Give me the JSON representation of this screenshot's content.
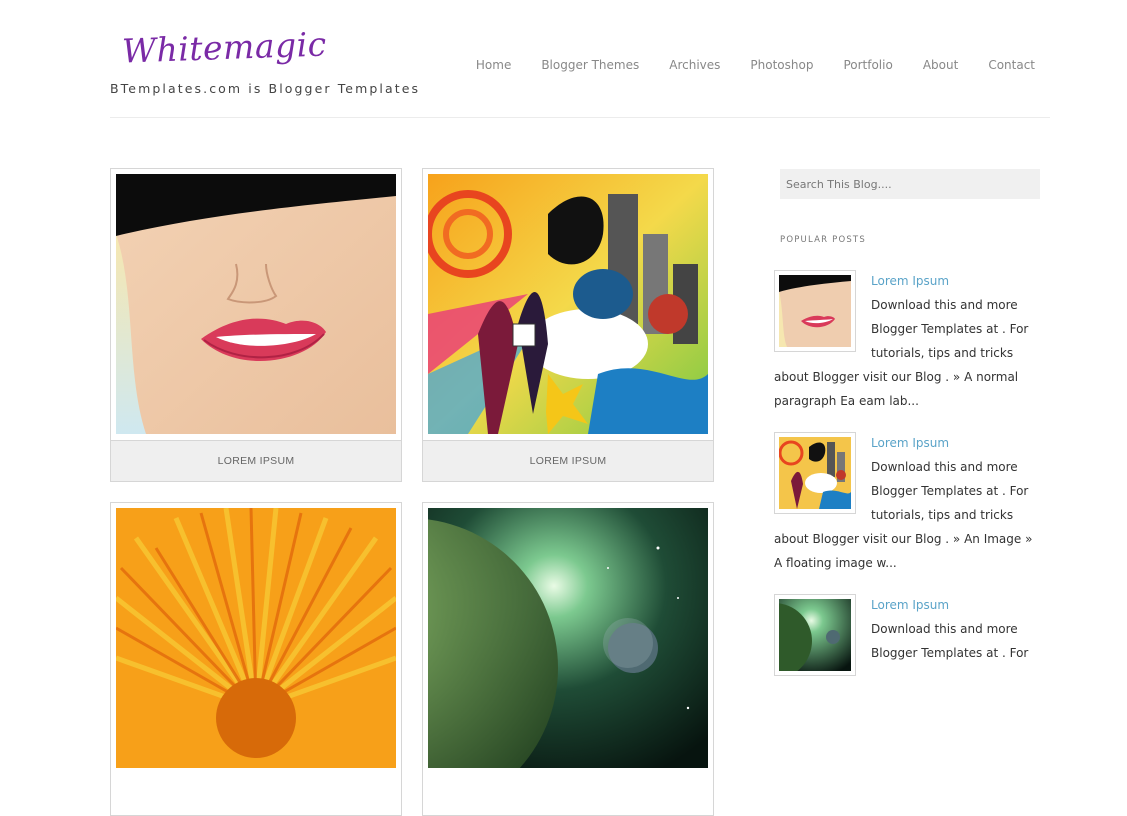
{
  "header": {
    "logo_text": "Whitemagic",
    "tagline": "BTemplates.com is Blogger Templates",
    "nav": [
      "Home",
      "Blogger Themes",
      "Archives",
      "Photoshop",
      "Portfolio",
      "About",
      "Contact"
    ]
  },
  "posts": [
    {
      "caption": "LOREM IPSUM",
      "image": "lips-face-illustration"
    },
    {
      "caption": "LOREM IPSUM",
      "image": "colorful-party-vector-art"
    },
    {
      "caption": "",
      "image": "orange-gerbera-flower"
    },
    {
      "caption": "",
      "image": "green-planet-space"
    }
  ],
  "sidebar": {
    "search_placeholder": "Search This Blog....",
    "popular_title": "POPULAR POSTS",
    "popular_posts": [
      {
        "title": "Lorem Ipsum",
        "excerpt": "Download this and more Blogger Templates at . For tutorials, tips and tricks about Blogger visit our Blog . » A normal paragraph Ea eam lab...",
        "image": "lips-face-illustration"
      },
      {
        "title": "Lorem Ipsum",
        "excerpt": "Download this and more Blogger Templates at . For tutorials, tips and tricks about Blogger visit our Blog . » An Image » A floating image w...",
        "image": "colorful-party-vector-art"
      },
      {
        "title": "Lorem Ipsum",
        "excerpt": "Download this and more Blogger Templates at . For",
        "image": "green-planet-space"
      }
    ]
  },
  "colors": {
    "logo": "#7a2aa6",
    "link": "#5aa3c8",
    "nav": "#888888",
    "caption_bg": "#efefef"
  }
}
